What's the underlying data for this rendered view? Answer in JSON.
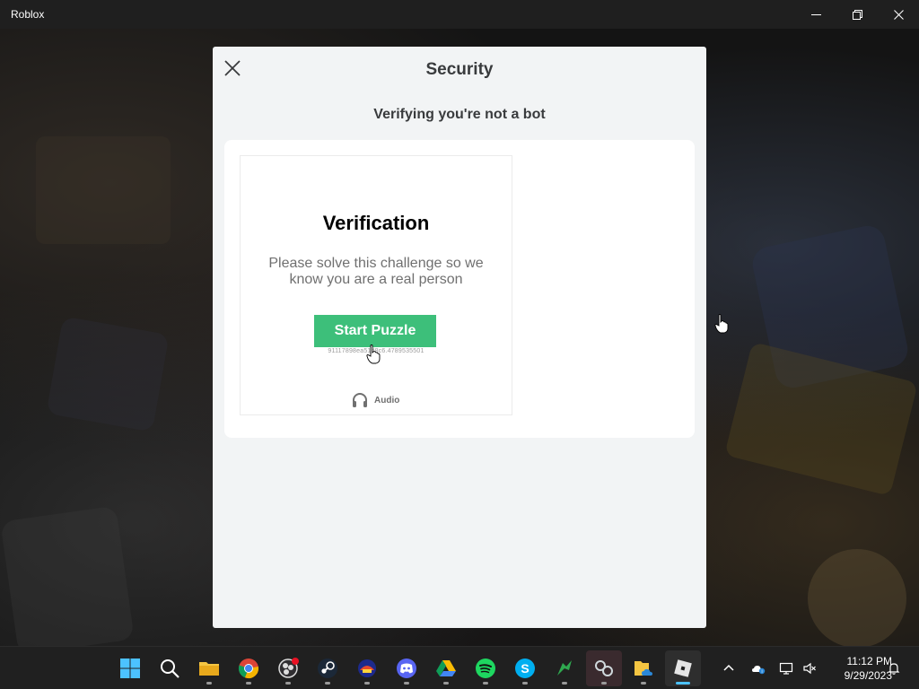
{
  "window": {
    "title": "Roblox",
    "buttons": [
      "minimize",
      "restore",
      "close"
    ]
  },
  "modal": {
    "title": "Security",
    "subtitle": "Verifying you're not a bot",
    "close_icon": "close-icon"
  },
  "challenge": {
    "title": "Verification",
    "description": "Please solve this challenge so we know you are a real person",
    "start_button": "Start Puzzle",
    "session_id": "91117898ea51d8c6.4789535501",
    "audio_label": "Audio",
    "accent_color": "#3dbf7a"
  },
  "taskbar": {
    "apps": [
      {
        "name": "start-icon"
      },
      {
        "name": "search-icon"
      },
      {
        "name": "file-explorer-icon"
      },
      {
        "name": "chrome-icon"
      },
      {
        "name": "obs-icon"
      },
      {
        "name": "steam-icon"
      },
      {
        "name": "game-launcher-icon"
      },
      {
        "name": "discord-icon"
      },
      {
        "name": "google-drive-icon"
      },
      {
        "name": "spotify-icon"
      },
      {
        "name": "skype-icon"
      },
      {
        "name": "game-icon"
      },
      {
        "name": "app-icon"
      },
      {
        "name": "folder-cloud-icon"
      },
      {
        "name": "roblox-icon"
      }
    ],
    "clock_time": "11:12 PM",
    "clock_date": "9/29/2023"
  }
}
